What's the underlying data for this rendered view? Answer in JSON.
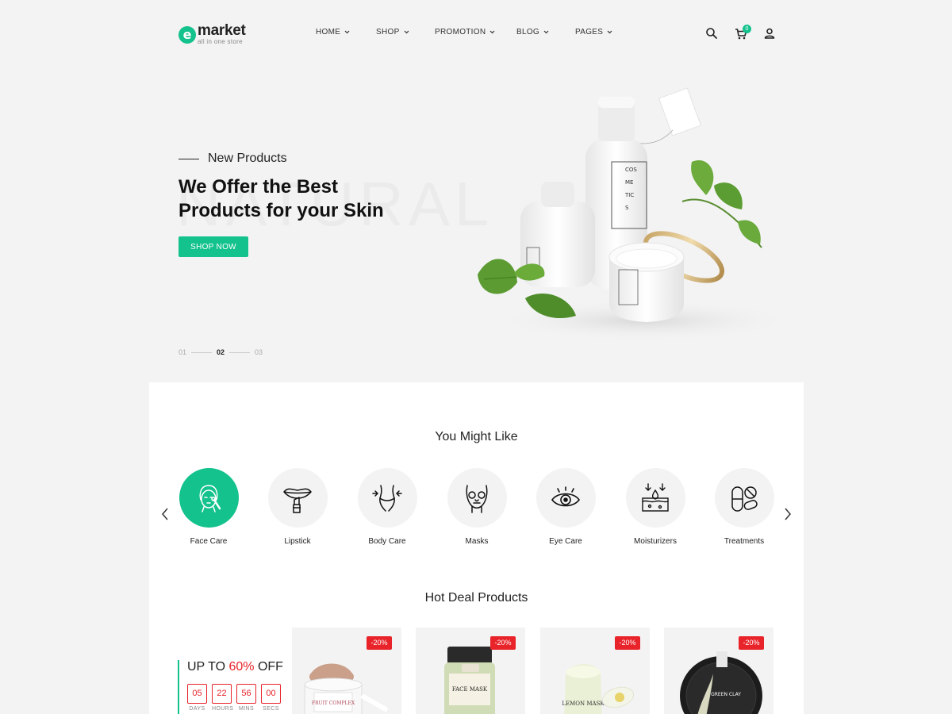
{
  "brand": {
    "name": "market",
    "logo_letter": "e",
    "tagline": "all in one store"
  },
  "nav": [
    {
      "label": "HOME"
    },
    {
      "label": "SHOP"
    },
    {
      "label": "PROMOTION"
    },
    {
      "label": "BLOG"
    },
    {
      "label": "PAGES"
    }
  ],
  "header": {
    "cart_count": "0",
    "icons": [
      "search-icon",
      "cart-icon",
      "user-icon"
    ]
  },
  "hero": {
    "eyebrow": "New Products",
    "title_line1": "We Offer the Best",
    "title_line2": "Products for your Skin",
    "watermark": "NATURAL",
    "button": "SHOP NOW",
    "slides": [
      "01",
      "02",
      "03"
    ],
    "active_slide": "02",
    "product_labels": [
      "COS",
      "ME",
      "TIC",
      "S"
    ]
  },
  "categories_section": {
    "title": "You Might Like",
    "items": [
      {
        "label": "Face Care",
        "icon": "face-care-icon"
      },
      {
        "label": "Lipstick",
        "icon": "lipstick-icon"
      },
      {
        "label": "Body Care",
        "icon": "body-care-icon"
      },
      {
        "label": "Masks",
        "icon": "mask-icon"
      },
      {
        "label": "Eye Care",
        "icon": "eye-icon"
      },
      {
        "label": "Moisturizers",
        "icon": "moisturizer-icon"
      },
      {
        "label": "Treatments",
        "icon": "pills-icon"
      }
    ]
  },
  "deals": {
    "title": "Hot Deal Products",
    "headline_prefix": "UP TO ",
    "headline_pct": "60%",
    "headline_suffix": " OFF",
    "timer": [
      {
        "value": "05",
        "label": "DAYS"
      },
      {
        "value": "22",
        "label": "HOURS"
      },
      {
        "value": "56",
        "label": "MINS"
      },
      {
        "value": "00",
        "label": "SECS"
      }
    ],
    "products": [
      {
        "badge": "-20%",
        "label": "FRUIT COMPLEX"
      },
      {
        "badge": "-20%",
        "label": "FACE MASK"
      },
      {
        "badge": "-20%",
        "label": "LEMON MASK"
      },
      {
        "badge": "-20%",
        "label": "GREEN CLAY"
      }
    ]
  },
  "colors": {
    "accent": "#13c28c",
    "sale": "#e8232a",
    "bg": "#f3f3f3"
  }
}
